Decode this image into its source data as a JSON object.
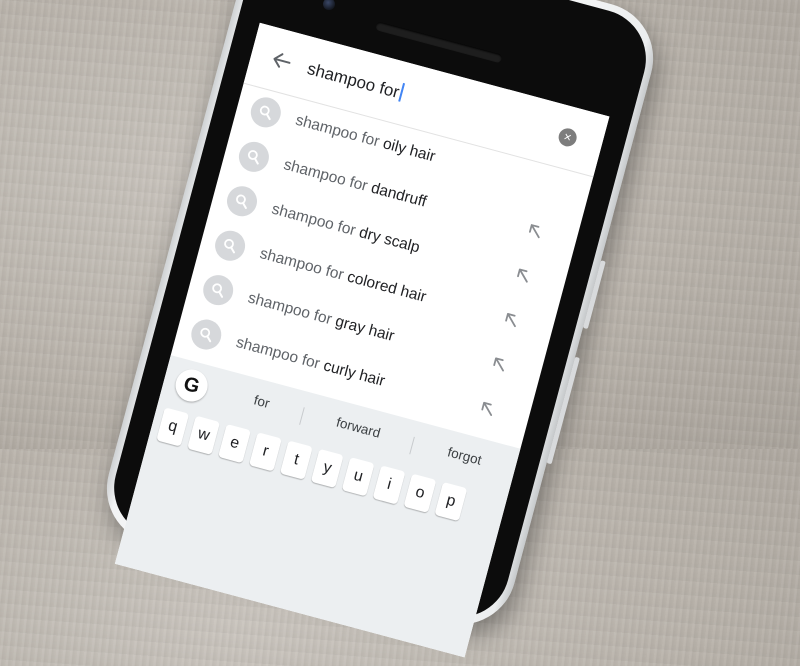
{
  "search": {
    "query": "shampoo for",
    "clear_icon": "close-circle-icon"
  },
  "suggestions": [
    {
      "prefix": "shampoo for ",
      "suffix": "oily hair"
    },
    {
      "prefix": "shampoo for ",
      "suffix": "dandruff"
    },
    {
      "prefix": "shampoo for ",
      "suffix": "dry scalp"
    },
    {
      "prefix": "shampoo for ",
      "suffix": "colored hair"
    },
    {
      "prefix": "shampoo for ",
      "suffix": "gray hair"
    },
    {
      "prefix": "shampoo for ",
      "suffix": "curly hair"
    }
  ],
  "keyboard": {
    "google_button": "G",
    "predictions": [
      "for",
      "forward",
      "forgot"
    ],
    "keys_row1": [
      "q",
      "w",
      "e",
      "r",
      "t",
      "y",
      "u",
      "i",
      "o",
      "p"
    ]
  },
  "colors": {
    "cursor": "#4285f4",
    "suggestion_icon_bg": "#d6d8db",
    "prefix_text": "#5f6368",
    "suffix_text": "#202124"
  }
}
